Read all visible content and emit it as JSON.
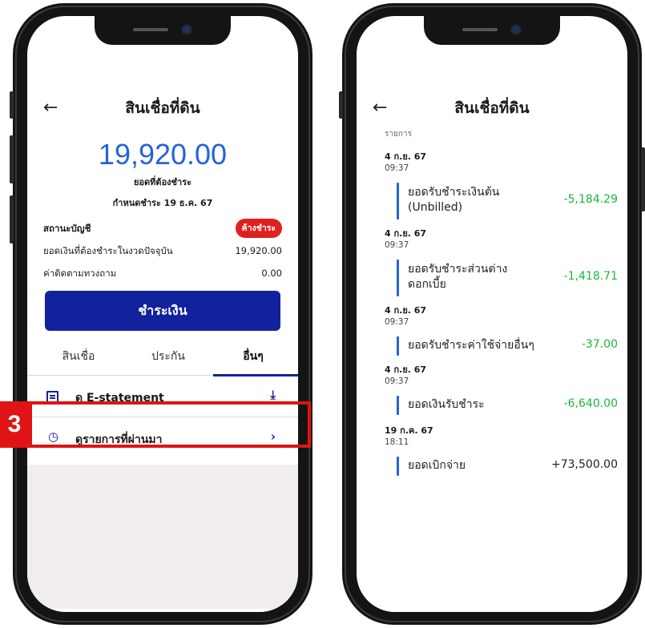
{
  "left_phone": {
    "title": "สินเชื่อที่ดิน",
    "amount": "19,920.00",
    "amount_label": "ยอดที่ต้องชำระ",
    "due_date": "กำหนดชำระ 19 ธ.ค. 67",
    "account_status_label": "สถานะบัญชี",
    "account_status_badge": "ค้างชำระ",
    "current_due_label": "ยอดเงินที่ต้องชำระในงวดปัจจุบัน",
    "current_due_value": "19,920.00",
    "collection_fee_label": "ค่าติดตามทวงถาม",
    "collection_fee_value": "0.00",
    "pay_button": "ชำระเงิน",
    "tabs": [
      "สินเชื่อ",
      "ประกัน",
      "อื่นๆ"
    ],
    "active_tab": "อื่นๆ",
    "menu": [
      {
        "label": "ดู E-statement",
        "icon": "document-icon",
        "action_icon": "download-icon"
      },
      {
        "label": "ดูรายการที่ผ่านมา",
        "icon": "history-icon",
        "action_icon": "chevron-right-icon"
      }
    ],
    "step_number": "3"
  },
  "right_phone": {
    "title": "สินเชื่อที่ดิน",
    "section_label": "รายการ",
    "transactions": [
      {
        "date": "4 ก.ย. 67",
        "time": "09:37",
        "desc_line1": "ยอดรับชำระเงินต้น",
        "desc_line2": "(Unbilled)",
        "amount": "-5,184.29"
      },
      {
        "date": "4 ก.ย. 67",
        "time": "09:37",
        "desc_line1": "ยอดรับชำระส่วนต่าง",
        "desc_line2": "ดอกเบี้ย",
        "amount": "-1,418.71"
      },
      {
        "date": "4 ก.ย. 67",
        "time": "09:37",
        "desc_line1": "ยอดรับชำระค่าใช้จ่ายอื่นๆ",
        "desc_line2": "",
        "amount": "-37.00"
      },
      {
        "date": "4 ก.ย. 67",
        "time": "09:37",
        "desc_line1": "ยอดเงินรับชำระ",
        "desc_line2": "",
        "amount": "-6,640.00"
      },
      {
        "date": "19 ก.ค. 67",
        "time": "18:11",
        "desc_line1": "ยอดเบิกจ่าย",
        "desc_line2": "",
        "amount": "+73,500.00"
      }
    ]
  },
  "colors": {
    "primary_blue": "#12229c",
    "amount_blue": "#2563d9",
    "alert_red": "#e01414",
    "negative_green": "#19b83a"
  }
}
